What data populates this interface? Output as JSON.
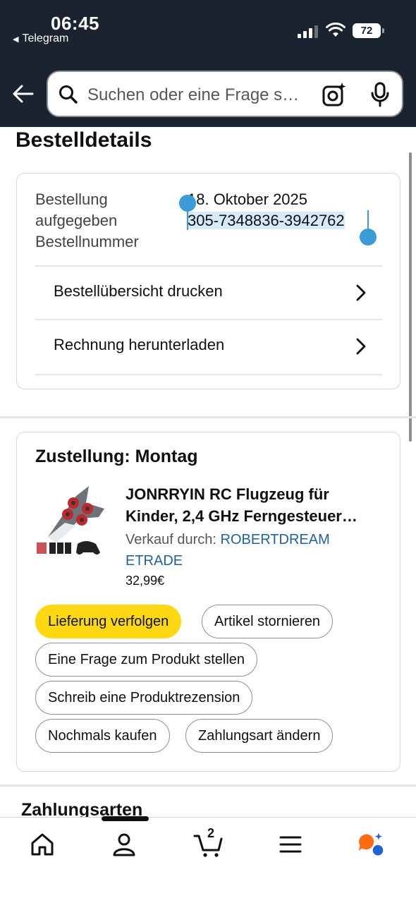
{
  "status_bar": {
    "time": "06:45",
    "back_app": "Telegram",
    "battery": "72"
  },
  "search": {
    "placeholder": "Suchen oder eine Frage s…"
  },
  "page_title": "Bestelldetails",
  "order_info": {
    "label_lines": [
      "Bestellung",
      "aufgegeben",
      "Bestellnummer"
    ],
    "date": "18. Oktober 2025",
    "order_number": "305-7348836-3942762",
    "links": [
      "Bestellübersicht drucken",
      "Rechnung herunterladen"
    ]
  },
  "delivery": {
    "title": "Zustellung: Montag",
    "product": {
      "name_line1": "JONRRYIN RC Flugzeug für",
      "name_line2": "Kinder, 2,4 GHz Ferngesteuer…",
      "seller_prefix": "Verkauf durch:",
      "seller_name_line1": "ROBERTDREAM",
      "seller_name_line2": "ETRADE",
      "price": "32,99€"
    },
    "buttons": {
      "track": "Lieferung verfolgen",
      "cancel": "Artikel stornieren",
      "ask": "Eine Frage zum Produkt stellen",
      "review": "Schreib eine Produktrezension",
      "buy_again": "Nochmals kaufen",
      "change_payment": "Zahlungsart ändern"
    }
  },
  "payment_section_title": "Zahlungsarten",
  "bottom_nav": {
    "cart_count": "2"
  },
  "colors": {
    "header_bg": "#1b2330",
    "primary_button": "#ffd814",
    "link": "#2162a1",
    "selection_handle": "#3b9bd4"
  }
}
